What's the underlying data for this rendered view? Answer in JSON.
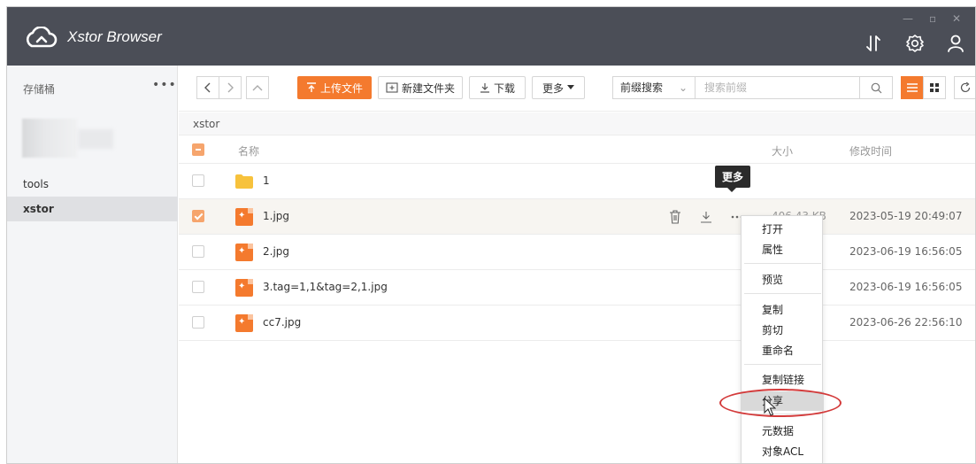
{
  "app": {
    "title": "Xstor Browser"
  },
  "window_controls": {
    "minimize": "—",
    "maximize": "▫",
    "close": "✕"
  },
  "sidebar": {
    "title": "存储桶",
    "more": "•••",
    "items": [
      {
        "label": "tools",
        "active": false
      },
      {
        "label": "xstor",
        "active": true
      }
    ]
  },
  "toolbar": {
    "upload_label": "上传文件",
    "new_folder_label": "新建文件夹",
    "download_label": "下载",
    "more_label": "更多",
    "prefix_search_label": "前缀搜索",
    "search_placeholder": "搜索前缀"
  },
  "breadcrumb": {
    "path": "xstor"
  },
  "table": {
    "headers": {
      "name": "名称",
      "size": "大小",
      "modified": "修改时间"
    },
    "rows": [
      {
        "type": "folder",
        "name": "1",
        "size": "",
        "modified": "",
        "checked": false
      },
      {
        "type": "image",
        "name": "1.jpg",
        "size": "406.43 KB",
        "modified": "2023-05-19 20:49:07",
        "checked": true
      },
      {
        "type": "image",
        "name": "2.jpg",
        "size": "",
        "modified": "2023-06-19 16:56:05",
        "checked": false
      },
      {
        "type": "image",
        "name": "3.tag=1,1&tag=2,1.jpg",
        "size": "",
        "modified": "2023-06-19 16:56:05",
        "checked": false
      },
      {
        "type": "image",
        "name": "cc7.jpg",
        "size": "",
        "modified": "2023-06-26 22:56:10",
        "checked": false
      }
    ]
  },
  "tooltip": {
    "text": "更多"
  },
  "context_menu": {
    "items": [
      "打开",
      "属性",
      "预览",
      "复制",
      "剪切",
      "重命名",
      "复制链接",
      "分享",
      "元数据",
      "对象ACL"
    ],
    "hovered": "分享"
  },
  "colors": {
    "accent": "#f47a2e",
    "titlebar": "#4b4e57",
    "annotation": "#d33a3a"
  },
  "icons": [
    "cloud-logo-icon",
    "transfer-icon",
    "settings-icon",
    "user-icon",
    "file-image-icon",
    "folder-icon",
    "trash-icon",
    "download-icon",
    "more-icon",
    "search-icon",
    "list-view-icon",
    "grid-view-icon",
    "refresh-icon"
  ]
}
